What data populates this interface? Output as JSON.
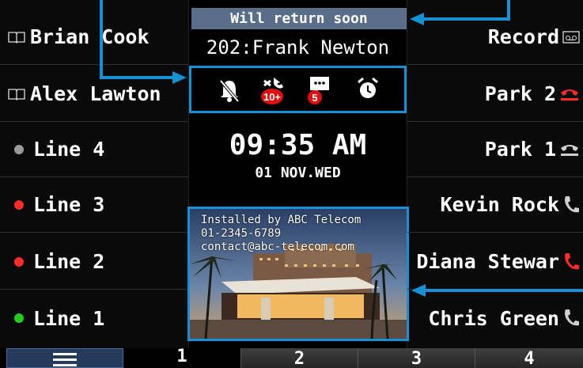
{
  "status_banner": "Will return soon",
  "extension_name": "202:Frank Newton",
  "clock": {
    "time": "09:35 AM",
    "date": "01 NOV.WED"
  },
  "notification_icons": [
    {
      "name": "dnd-bell-icon",
      "badge": ""
    },
    {
      "name": "missed-call-icon",
      "badge": "10+"
    },
    {
      "name": "voicemail-icon",
      "badge": "5"
    },
    {
      "name": "alarm-clock-icon",
      "badge": ""
    }
  ],
  "left_keys": [
    {
      "label": "Brian Cook",
      "icon": "book-icon"
    },
    {
      "label": "Alex Lawton",
      "icon": "book-icon"
    },
    {
      "label": "Line 4",
      "status_color": "#9a9a9a"
    },
    {
      "label": "Line 3",
      "status_color": "#ff2a2a"
    },
    {
      "label": "Line 2",
      "status_color": "#ff2a2a"
    },
    {
      "label": "Line 1",
      "status_color": "#22cc22"
    }
  ],
  "right_keys": [
    {
      "label": "Record",
      "icon": "voicemail-tape-icon"
    },
    {
      "label": "Park 2",
      "icon": "park-handset-icon",
      "color": "#ff2a2a"
    },
    {
      "label": "Park 1",
      "icon": "park-handset-icon",
      "color": "#cfcfcf"
    },
    {
      "label": "Kevin Rock",
      "icon": "handset-icon",
      "color": "#cfcfcf"
    },
    {
      "label": "Diana Stewar",
      "icon": "handset-icon",
      "color": "#ff2a2a"
    },
    {
      "label": "Chris Green",
      "icon": "handset-icon",
      "color": "#cfcfcf"
    }
  ],
  "photo_text": [
    "Installed by ABC Telecom",
    "01-2345-6789",
    "contact@abc-telecom.com"
  ],
  "tabs": [
    {
      "label": "≡",
      "name": "menu-icon"
    },
    {
      "label": "1"
    },
    {
      "label": "2"
    },
    {
      "label": "3"
    },
    {
      "label": "4"
    }
  ],
  "colors": {
    "callout": "#1791d6",
    "banner": "#5a6e8c"
  }
}
